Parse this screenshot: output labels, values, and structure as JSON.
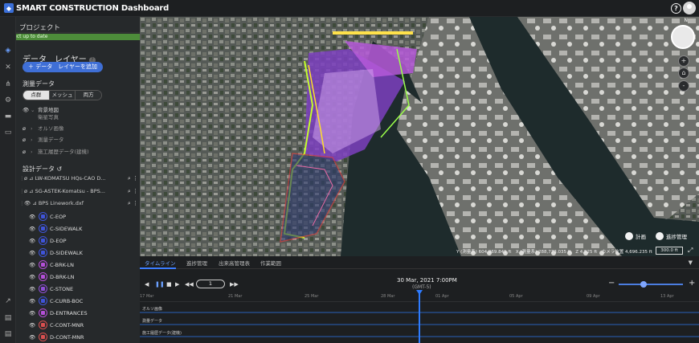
{
  "app": {
    "title": "SMART CONSTRUCTION Dashboard"
  },
  "header": {
    "help_icon": "question-circle-icon",
    "avatar_icon": "user-avatar"
  },
  "panel": {
    "title": "プロジェクト",
    "status": "Project up to date",
    "data_layers_title": "データ　レイヤー",
    "add_layer_label": "＋ データ　レイヤーを追加",
    "survey_title": "測量データ",
    "survey_modes": [
      "点群",
      "メッシュ",
      "両方"
    ],
    "survey_selected": "点群",
    "survey_items": [
      {
        "label": "背景地図",
        "sub": "衛星写真"
      },
      {
        "label": "オルソ画像"
      },
      {
        "label": "測量データ"
      },
      {
        "label": "施工履歴データ(建機)"
      }
    ],
    "design_title": "設計データ",
    "design_files": [
      {
        "label": "LW-KOMATSU HQs-CAO D..."
      },
      {
        "label": "SG-ASTEK-Komatsu - BPS..."
      },
      {
        "label": "BPS Linework.dxf"
      }
    ],
    "layers": [
      {
        "label": "C-EOP",
        "color": "#3f54d8"
      },
      {
        "label": "C-SIDEWALK",
        "color": "#3f54d8"
      },
      {
        "label": "D-EOP",
        "color": "#3f54d8"
      },
      {
        "label": "D-SIDEWALK",
        "color": "#3f54d8"
      },
      {
        "label": "C-BRK-LN",
        "color": "#b34fd8"
      },
      {
        "label": "D-BRK-LN",
        "color": "#b34fd8"
      },
      {
        "label": "C-STONE",
        "color": "#8e4fd8"
      },
      {
        "label": "C-CURB-BOC",
        "color": "#3f54d8"
      },
      {
        "label": "D-ENTRANCES",
        "color": "#b34fd8"
      },
      {
        "label": "C-CONT-MNR",
        "color": "#d84f4f"
      },
      {
        "label": "D-CONT-MNR",
        "color": "#d84f4f"
      }
    ]
  },
  "map": {
    "compass_label": "N",
    "zoom_in": "+",
    "zoom_out": "-",
    "home_icon": "home-icon",
    "toggle_plan": "計画",
    "toggle_progress": "進捗管理",
    "coords": {
      "y": "Y (測量系) 604,969.841 ft",
      "x": "X (測量系) 288,773.035 ft",
      "z": "Z 4.525 ft",
      "camera": "カメラ位置 4,696.235 ft"
    },
    "scale": "300.0 ft"
  },
  "timeline": {
    "tabs": [
      "タイムライン",
      "進捗管理",
      "出来高管理表",
      "作業範囲"
    ],
    "active_tab": "タイムライン",
    "datetime": "30 Mar, 2021 7:00PM",
    "timezone": "(GMT-5)",
    "speed": "1",
    "ticks": [
      "17 Mar",
      "21 Mar",
      "25 Mar",
      "28 Mar",
      "01 Apr",
      "05 Apr",
      "09 Apr",
      "13 Apr"
    ],
    "tracks": [
      "オルソ画像",
      "測量データ",
      "施工履歴データ(建機)"
    ]
  },
  "colors": {
    "accent": "#3b7cff",
    "status_green": "#4d8c3a",
    "panel_bg": "#26292b"
  }
}
